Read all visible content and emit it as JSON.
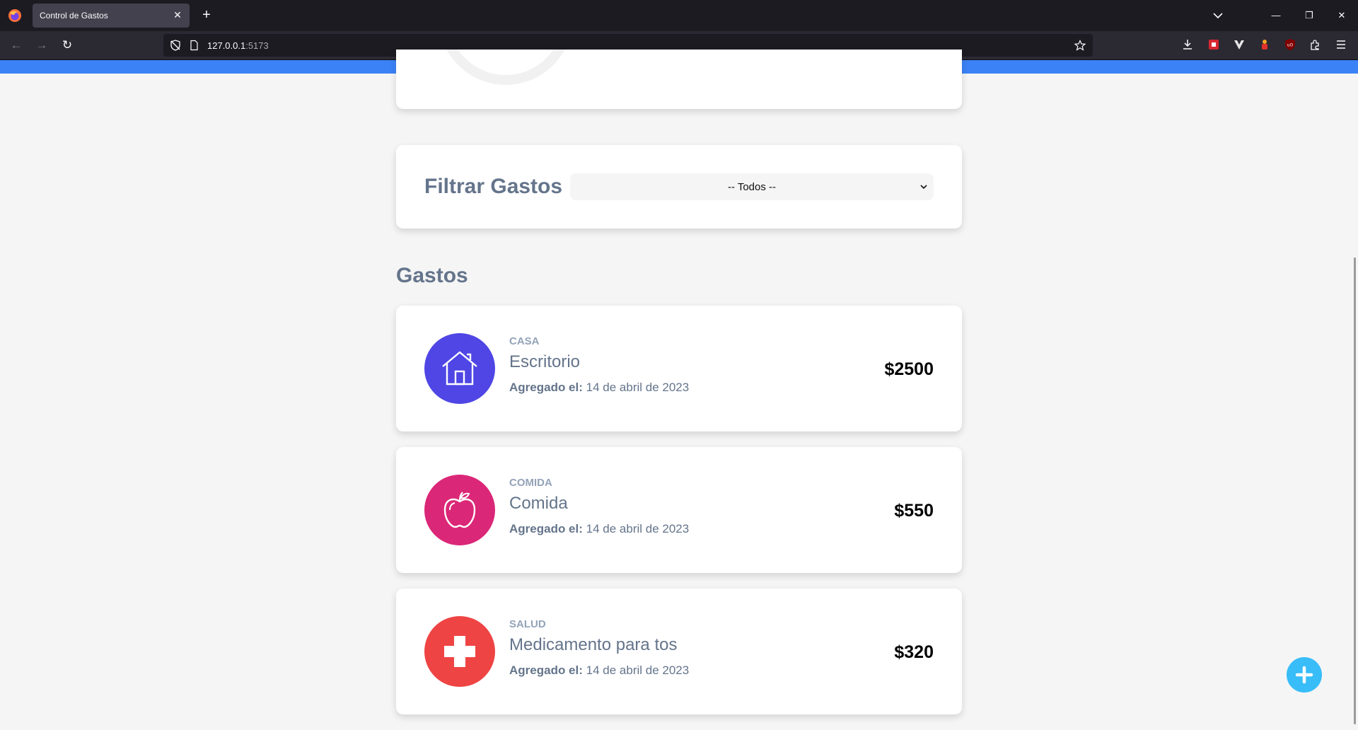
{
  "browser": {
    "tab_title": "Control de Gastos",
    "tab_close": "✕",
    "new_tab": "+",
    "url_host": "127.0.0.1",
    "url_port": ":5173",
    "window_buttons": {
      "minimize": "—",
      "restore": "❐",
      "close": "✕"
    }
  },
  "filter": {
    "label": "Filtrar Gastos",
    "selected": "-- Todos --"
  },
  "expenses_section": {
    "title": "Gastos",
    "items": [
      {
        "category": "Casa",
        "name": "Escritorio",
        "date_label": "Agregado el:",
        "date": "14 de abril de 2023",
        "amount": "$2500",
        "icon": "house-icon",
        "color": "#4f46e5"
      },
      {
        "category": "Comida",
        "name": "Comida",
        "date_label": "Agregado el:",
        "date": "14 de abril de 2023",
        "amount": "$550",
        "icon": "apple-icon",
        "color": "#db2777"
      },
      {
        "category": "Salud",
        "name": "Medicamento para tos",
        "date_label": "Agregado el:",
        "date": "14 de abril de 2023",
        "amount": "$320",
        "icon": "medical-cross-icon",
        "color": "#ef4444"
      }
    ]
  },
  "colors": {
    "header_blue": "#3b82f6",
    "fab": "#38bdf8",
    "heading": "#64748b"
  },
  "fab_icon": "plus-icon"
}
